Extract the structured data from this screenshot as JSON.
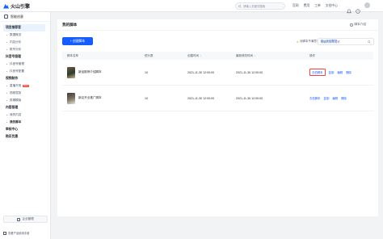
{
  "topbar": {
    "brand": "火山引擎",
    "search_placeholder": "请输入关键词搜索",
    "nav": [
      "官网",
      "费用",
      "工单",
      "文档中心"
    ]
  },
  "sidebar": {
    "header": "智能创意",
    "groups": [
      {
        "title": "项目推荐官",
        "active": true,
        "items": [
          {
            "label": "数据概览"
          },
          {
            "label": "内容分析"
          },
          {
            "label": "账号分析"
          }
        ]
      },
      {
        "title": "抖音号管理",
        "items": [
          {
            "label": "抖音号管理"
          },
          {
            "label": "抖音号配置"
          }
        ]
      },
      {
        "title": "视频制作",
        "items": [
          {
            "label": "直播开剪",
            "badge": "New"
          },
          {
            "label": "视频混剪"
          },
          {
            "label": "剪辑模版"
          }
        ]
      },
      {
        "title": "内容管理",
        "items": [
          {
            "label": "我的内容"
          },
          {
            "label": "我的脚本",
            "active": true
          }
        ]
      },
      {
        "title": "审核中心",
        "items": []
      },
      {
        "title": "购买优惠",
        "items": []
      }
    ],
    "bottom_button": "企业管理",
    "footer": "查看产品使用手册"
  },
  "main": {
    "title": "我的脚本",
    "intro_link": "脚本介绍",
    "tip_text": "对脚本不满意？",
    "tip_link": "请让我们帮您",
    "new_button": "+ 创建脚本",
    "search_placeholder": "请输入脚本名称",
    "columns": [
      "脚本名称",
      "镜头数",
      "创建时间",
      "最新修改时间",
      "操作"
    ],
    "rows": [
      {
        "name": "新品推荐介绍脚本",
        "shots": "10",
        "created": "2021-11-30 12:00:00",
        "modified": "2021-11-30 12:00:00",
        "ops": [
          "去拍脚本",
          "复制",
          "编辑",
          "删除"
        ]
      },
      {
        "name": "新店开业推广脚本",
        "shots": "10",
        "created": "2021-11-30 12:00:00",
        "modified": "2021-11-30 12:00:00",
        "ops": [
          "去拍脚本",
          "复制",
          "编辑",
          "删除"
        ]
      }
    ]
  },
  "colors": {
    "accent": "#165dff",
    "highlight": "#f53f3f"
  }
}
